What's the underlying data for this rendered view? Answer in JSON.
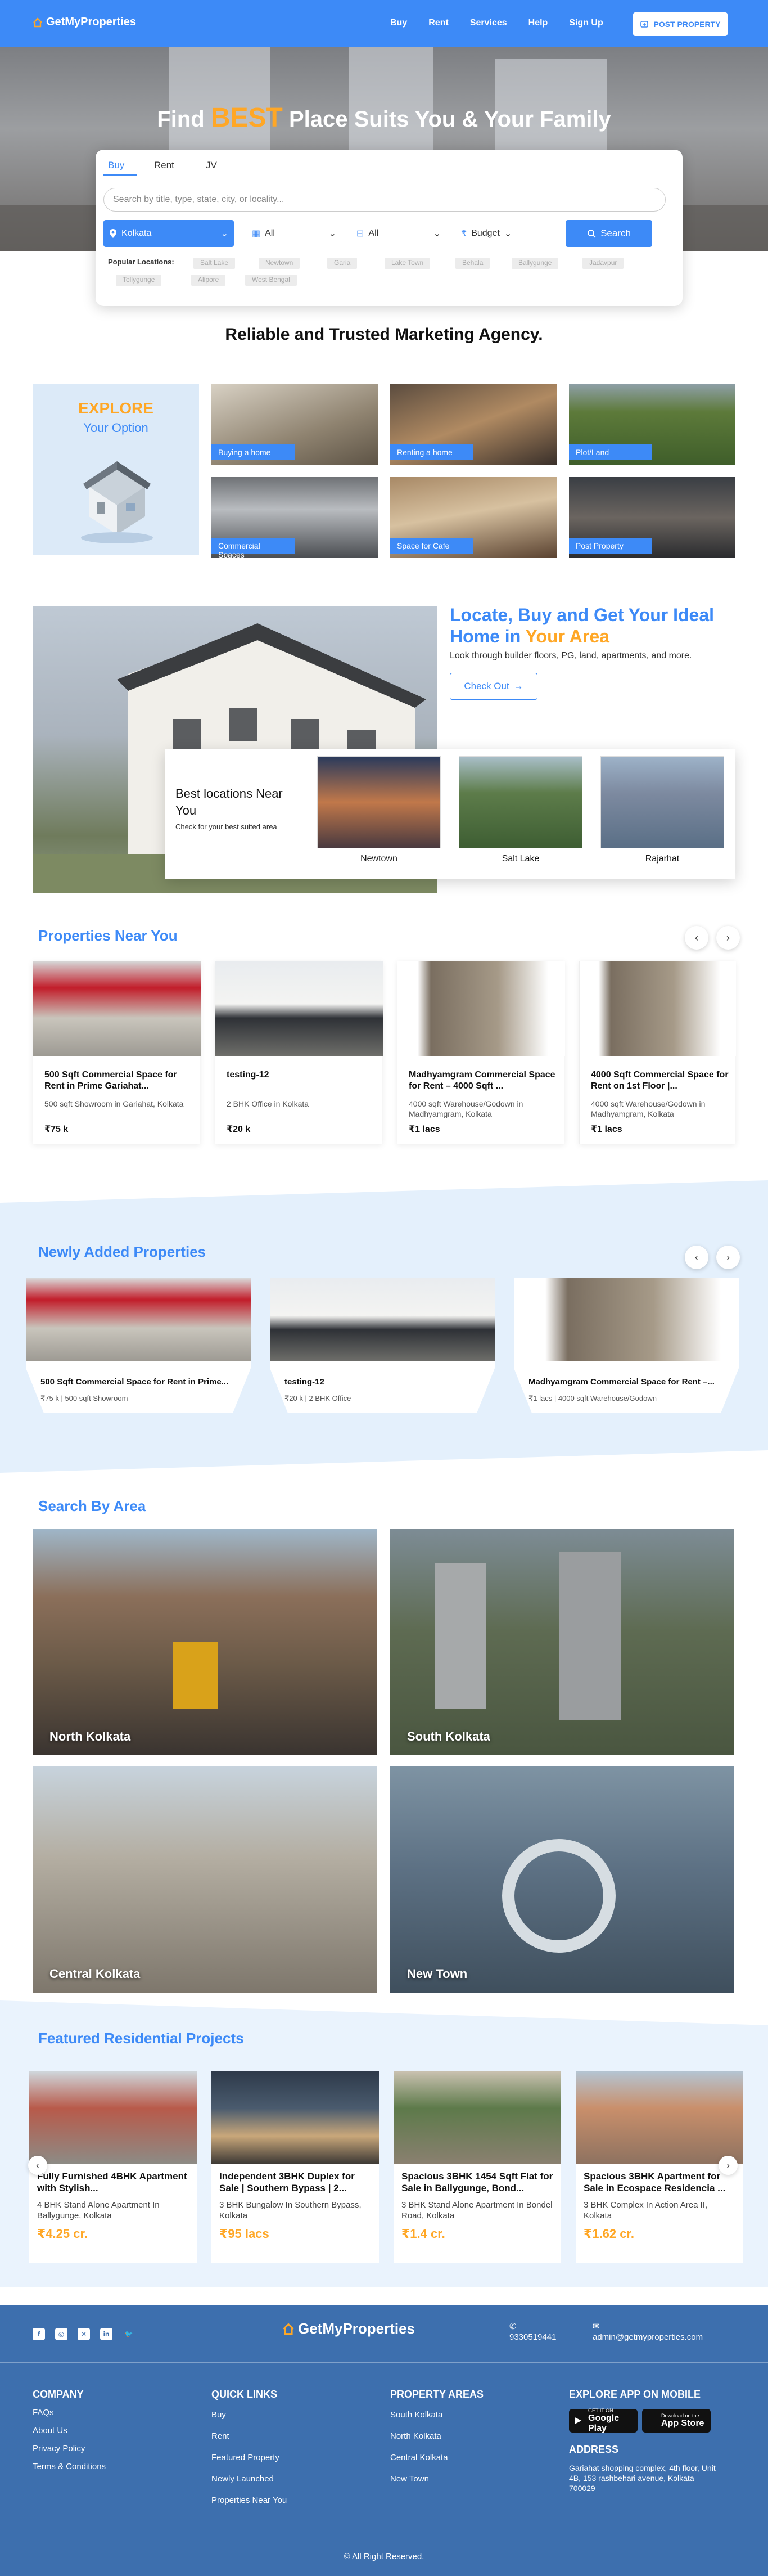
{
  "brand": {
    "name": "GetMyProperties",
    "accent": "#3d8af7",
    "orange": "#ffa726"
  },
  "nav": {
    "items": [
      "Buy",
      "Rent",
      "Services",
      "Help",
      "Sign Up"
    ],
    "post_property": "POST PROPERTY"
  },
  "hero": {
    "title_pre": "Find",
    "title_best": "BEST",
    "title_post": "Place Suits You & Your Family"
  },
  "search": {
    "tabs": [
      "Buy",
      "Rent",
      "JV"
    ],
    "placeholder": "Search by title, type, state, city, or locality...",
    "city": "Kolkata",
    "type1": "All",
    "type2": "All",
    "budget": "Budget",
    "button": "Search",
    "popular_label": "Popular Locations:",
    "popular": [
      "Salt Lake",
      "Newtown",
      "Garia",
      "Lake Town",
      "Behala",
      "Ballygunge",
      "Jadavpur",
      "Tollygunge",
      "Alipore",
      "West Bengal"
    ]
  },
  "reliable": "Reliable and Trusted Marketing Agency.",
  "explore": {
    "line1": "EXPLORE",
    "line2": "Your Option"
  },
  "categories": [
    "Buying a home",
    "Renting a home",
    "Plot/Land",
    "Commercial Spaces",
    "Space for Cafe",
    "Post Property"
  ],
  "locate": {
    "title_pre": "Locate, Buy and Get Your Ideal Home in",
    "title_highlight": "Your Area",
    "desc": "Look through builder floors, PG, land, apartments, and more.",
    "button": "Check Out"
  },
  "best_locations": {
    "title": "Best locations Near You",
    "sub": "Check for your best suited area",
    "places": [
      "Newtown",
      "Salt Lake",
      "Rajarhat"
    ]
  },
  "near_you": {
    "title": "Properties Near You",
    "cards": [
      {
        "title": "500 Sqft Commercial Space for Rent in Prime Gariahat...",
        "desc": "500 sqft Showroom in Gariahat, Kolkata",
        "price": "₹75 k"
      },
      {
        "title": "testing-12",
        "desc": "2 BHK Office in Kolkata",
        "price": "₹20 k"
      },
      {
        "title": "Madhyamgram Commercial Space for Rent – 4000 Sqft ...",
        "desc": "4000 sqft Warehouse/Godown in Madhyamgram, Kolkata",
        "price": "₹1 lacs"
      },
      {
        "title": "4000 Sqft Commercial Space for Rent on 1st Floor |...",
        "desc": "4000 sqft Warehouse/Godown in Madhyamgram, Kolkata",
        "price": "₹1 lacs"
      }
    ]
  },
  "newly": {
    "title": "Newly Added Properties",
    "cards": [
      {
        "title": "500 Sqft Commercial Space for Rent in Prime...",
        "sub": "₹75 k | 500 sqft Showroom"
      },
      {
        "title": "testing-12",
        "sub": "₹20 k | 2 BHK Office"
      },
      {
        "title": "Madhyamgram Commercial Space for Rent –...",
        "sub": "₹1 lacs | 4000 sqft Warehouse/Godown"
      }
    ]
  },
  "search_area": {
    "title": "Search By Area",
    "areas": [
      "North Kolkata",
      "South Kolkata",
      "Central Kolkata",
      "New Town"
    ]
  },
  "featured": {
    "title": "Featured Residential Projects",
    "cards": [
      {
        "title": "Fully Furnished 4BHK Apartment with Stylish...",
        "desc": "4 BHK Stand Alone Apartment In Ballygunge, Kolkata",
        "price": "₹4.25 cr."
      },
      {
        "title": "Independent 3BHK Duplex for Sale | Southern Bypass | 2...",
        "desc": "3 BHK Bungalow In Southern Bypass, Kolkata",
        "price": "₹95 lacs"
      },
      {
        "title": "Spacious 3BHK 1454 Sqft Flat for Sale in Ballygunge, Bond...",
        "desc": "3 BHK Stand Alone Apartment In Bondel Road, Kolkata",
        "price": "₹1.4 cr."
      },
      {
        "title": "Spacious 3BHK Apartment for Sale in Ecospace Residencia ...",
        "desc": "3 BHK Complex In Action Area II, Kolkata",
        "price": "₹1.62 cr."
      }
    ]
  },
  "footer": {
    "social": [
      "facebook-icon",
      "instagram-icon",
      "x-icon",
      "linkedin-icon",
      "twitter-icon"
    ],
    "phone": "9330519441",
    "email": "admin@getmyproperties.com",
    "company_head": "COMPANY",
    "company": [
      "FAQs",
      "About Us",
      "Privacy Policy",
      "Terms & Conditions"
    ],
    "quick_head": "QUICK LINKS",
    "quick": [
      "Buy",
      "Rent",
      "Featured Property",
      "Newly Launched",
      "Properties Near You"
    ],
    "areas_head": "PROPERTY AREAS",
    "areas": [
      "South Kolkata",
      "North Kolkata",
      "Central Kolkata",
      "New Town"
    ],
    "app_head": "EXPLORE APP ON MOBILE",
    "google_small": "GET IT ON",
    "google_big": "Google Play",
    "apple_small": "Download on the",
    "apple_big": "App Store",
    "address_head": "ADDRESS",
    "address": "Gariahat shopping complex, 4th floor, Unit 4B, 153 rashbehari avenue, Kolkata 700029",
    "copyright": "© All Right Reserved."
  }
}
